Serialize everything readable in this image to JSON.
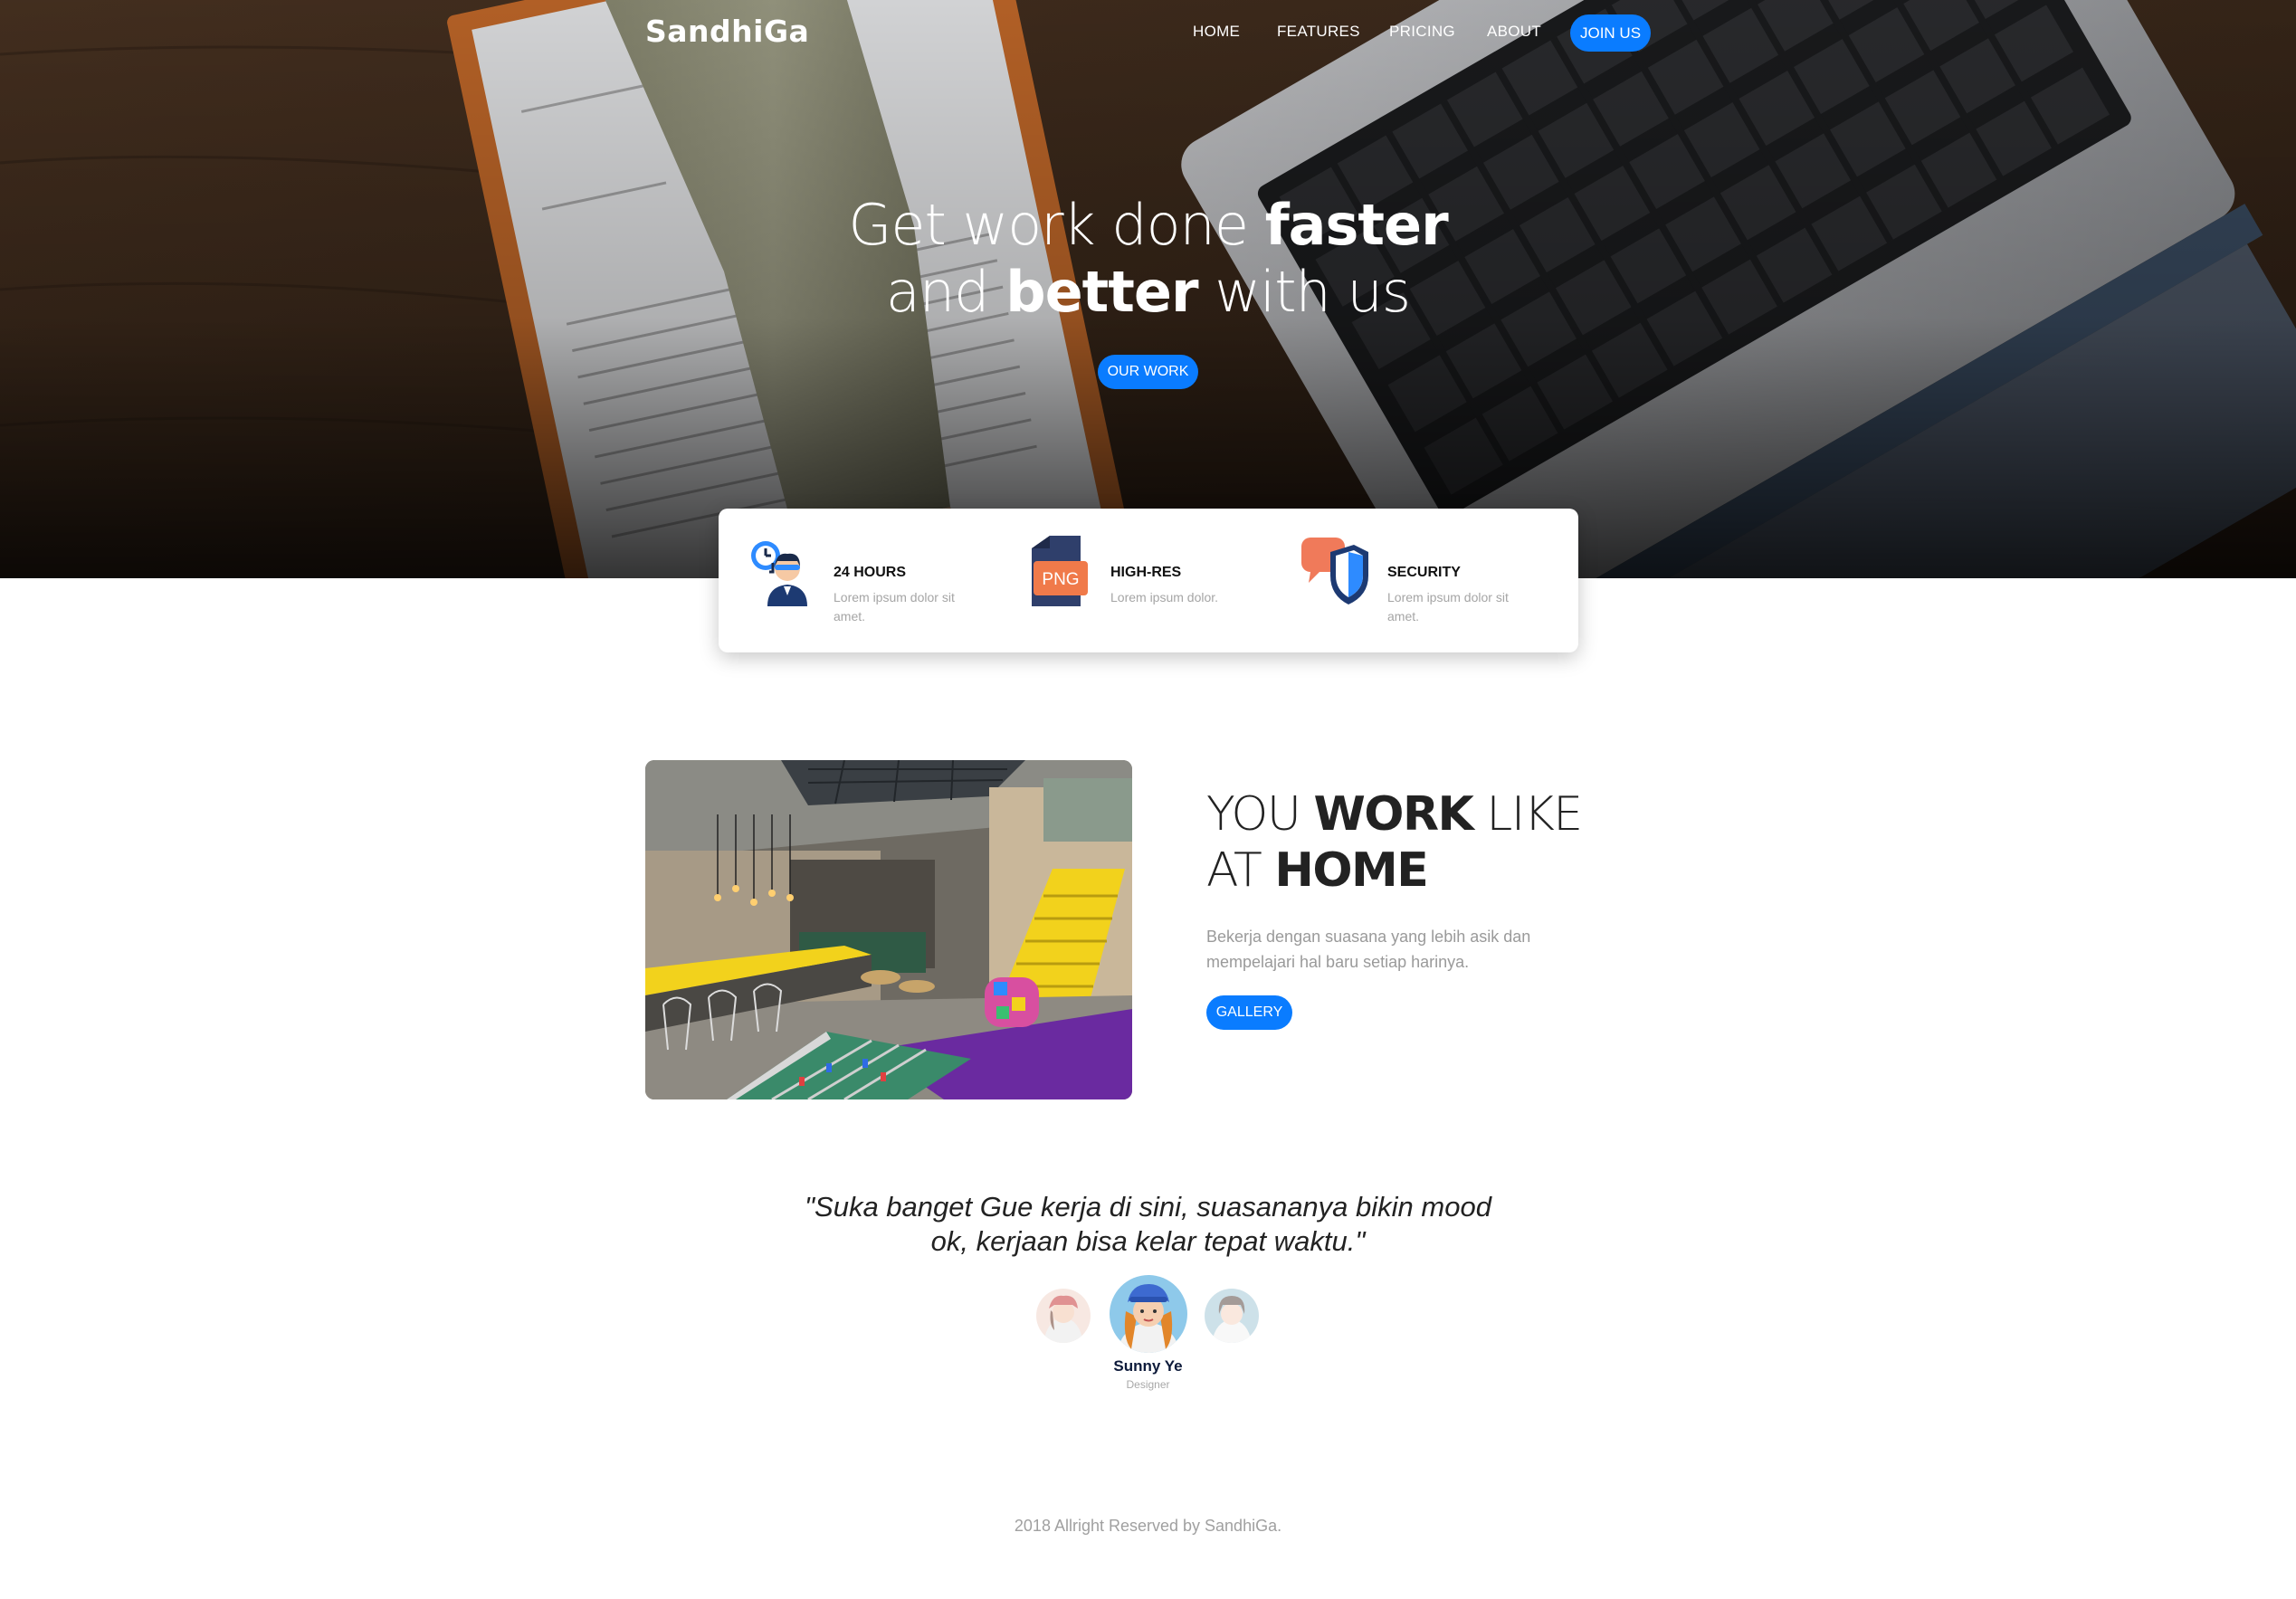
{
  "nav": {
    "brand": "SandhiGa",
    "links": [
      "HOME",
      "FEATURES",
      "PRICING",
      "ABOUT"
    ],
    "join_label": "JOIN US"
  },
  "hero": {
    "line1_a": "Get work done ",
    "line1_b": "faster",
    "line2_a": "and ",
    "line2_b": "better",
    "line2_c": " with us",
    "button_label": "OUR WORK"
  },
  "features": [
    {
      "title": "24 HOURS",
      "desc": "Lorem ipsum dolor sit amet.",
      "icon": "support-clock-icon"
    },
    {
      "title": "HIGH-RES",
      "desc": "Lorem ipsum dolor.",
      "icon": "png-file-icon",
      "badge": "PNG"
    },
    {
      "title": "SECURITY",
      "desc": "Lorem ipsum dolor sit amet.",
      "icon": "security-shield-icon"
    }
  ],
  "workspace": {
    "title_line1_a": "YOU ",
    "title_line1_b": "WORK",
    "title_line1_c": " LIKE",
    "title_line2_a": "AT ",
    "title_line2_b": "HOME",
    "description": "Bekerja dengan suasana yang lebih asik dan mempelajari hal baru setiap harinya.",
    "button_label": "GALLERY"
  },
  "testimonial": {
    "quote_line1": "\"Suka banget Gue kerja di sini, suasananya bikin mood",
    "quote_line2": "ok, kerjaan bisa kelar tepat waktu.\"",
    "name": "Sunny Ye",
    "role": "Designer"
  },
  "footer": {
    "text": "2018 Allright Reserved by SandhiGa."
  },
  "colors": {
    "accent": "#0a7cff",
    "text_dark": "#222222",
    "text_muted": "#a0a0a0"
  }
}
